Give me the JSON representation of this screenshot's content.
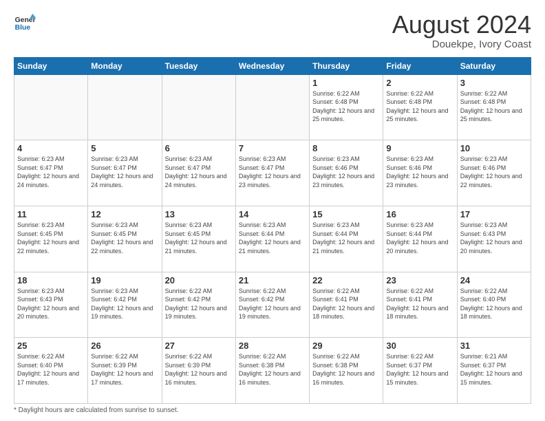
{
  "logo": {
    "line1": "General",
    "line2": "Blue"
  },
  "title": "August 2024",
  "location": "Douekpe, Ivory Coast",
  "header_days": [
    "Sunday",
    "Monday",
    "Tuesday",
    "Wednesday",
    "Thursday",
    "Friday",
    "Saturday"
  ],
  "footnote": "Daylight hours",
  "weeks": [
    [
      {
        "day": "",
        "info": ""
      },
      {
        "day": "",
        "info": ""
      },
      {
        "day": "",
        "info": ""
      },
      {
        "day": "",
        "info": ""
      },
      {
        "day": "1",
        "info": "Sunrise: 6:22 AM\nSunset: 6:48 PM\nDaylight: 12 hours\nand 25 minutes."
      },
      {
        "day": "2",
        "info": "Sunrise: 6:22 AM\nSunset: 6:48 PM\nDaylight: 12 hours\nand 25 minutes."
      },
      {
        "day": "3",
        "info": "Sunrise: 6:22 AM\nSunset: 6:48 PM\nDaylight: 12 hours\nand 25 minutes."
      }
    ],
    [
      {
        "day": "4",
        "info": "Sunrise: 6:23 AM\nSunset: 6:47 PM\nDaylight: 12 hours\nand 24 minutes."
      },
      {
        "day": "5",
        "info": "Sunrise: 6:23 AM\nSunset: 6:47 PM\nDaylight: 12 hours\nand 24 minutes."
      },
      {
        "day": "6",
        "info": "Sunrise: 6:23 AM\nSunset: 6:47 PM\nDaylight: 12 hours\nand 24 minutes."
      },
      {
        "day": "7",
        "info": "Sunrise: 6:23 AM\nSunset: 6:47 PM\nDaylight: 12 hours\nand 23 minutes."
      },
      {
        "day": "8",
        "info": "Sunrise: 6:23 AM\nSunset: 6:46 PM\nDaylight: 12 hours\nand 23 minutes."
      },
      {
        "day": "9",
        "info": "Sunrise: 6:23 AM\nSunset: 6:46 PM\nDaylight: 12 hours\nand 23 minutes."
      },
      {
        "day": "10",
        "info": "Sunrise: 6:23 AM\nSunset: 6:46 PM\nDaylight: 12 hours\nand 22 minutes."
      }
    ],
    [
      {
        "day": "11",
        "info": "Sunrise: 6:23 AM\nSunset: 6:45 PM\nDaylight: 12 hours\nand 22 minutes."
      },
      {
        "day": "12",
        "info": "Sunrise: 6:23 AM\nSunset: 6:45 PM\nDaylight: 12 hours\nand 22 minutes."
      },
      {
        "day": "13",
        "info": "Sunrise: 6:23 AM\nSunset: 6:45 PM\nDaylight: 12 hours\nand 21 minutes."
      },
      {
        "day": "14",
        "info": "Sunrise: 6:23 AM\nSunset: 6:44 PM\nDaylight: 12 hours\nand 21 minutes."
      },
      {
        "day": "15",
        "info": "Sunrise: 6:23 AM\nSunset: 6:44 PM\nDaylight: 12 hours\nand 21 minutes."
      },
      {
        "day": "16",
        "info": "Sunrise: 6:23 AM\nSunset: 6:44 PM\nDaylight: 12 hours\nand 20 minutes."
      },
      {
        "day": "17",
        "info": "Sunrise: 6:23 AM\nSunset: 6:43 PM\nDaylight: 12 hours\nand 20 minutes."
      }
    ],
    [
      {
        "day": "18",
        "info": "Sunrise: 6:23 AM\nSunset: 6:43 PM\nDaylight: 12 hours\nand 20 minutes."
      },
      {
        "day": "19",
        "info": "Sunrise: 6:23 AM\nSunset: 6:42 PM\nDaylight: 12 hours\nand 19 minutes."
      },
      {
        "day": "20",
        "info": "Sunrise: 6:22 AM\nSunset: 6:42 PM\nDaylight: 12 hours\nand 19 minutes."
      },
      {
        "day": "21",
        "info": "Sunrise: 6:22 AM\nSunset: 6:42 PM\nDaylight: 12 hours\nand 19 minutes."
      },
      {
        "day": "22",
        "info": "Sunrise: 6:22 AM\nSunset: 6:41 PM\nDaylight: 12 hours\nand 18 minutes."
      },
      {
        "day": "23",
        "info": "Sunrise: 6:22 AM\nSunset: 6:41 PM\nDaylight: 12 hours\nand 18 minutes."
      },
      {
        "day": "24",
        "info": "Sunrise: 6:22 AM\nSunset: 6:40 PM\nDaylight: 12 hours\nand 18 minutes."
      }
    ],
    [
      {
        "day": "25",
        "info": "Sunrise: 6:22 AM\nSunset: 6:40 PM\nDaylight: 12 hours\nand 17 minutes."
      },
      {
        "day": "26",
        "info": "Sunrise: 6:22 AM\nSunset: 6:39 PM\nDaylight: 12 hours\nand 17 minutes."
      },
      {
        "day": "27",
        "info": "Sunrise: 6:22 AM\nSunset: 6:39 PM\nDaylight: 12 hours\nand 16 minutes."
      },
      {
        "day": "28",
        "info": "Sunrise: 6:22 AM\nSunset: 6:38 PM\nDaylight: 12 hours\nand 16 minutes."
      },
      {
        "day": "29",
        "info": "Sunrise: 6:22 AM\nSunset: 6:38 PM\nDaylight: 12 hours\nand 16 minutes."
      },
      {
        "day": "30",
        "info": "Sunrise: 6:22 AM\nSunset: 6:37 PM\nDaylight: 12 hours\nand 15 minutes."
      },
      {
        "day": "31",
        "info": "Sunrise: 6:21 AM\nSunset: 6:37 PM\nDaylight: 12 hours\nand 15 minutes."
      }
    ]
  ]
}
